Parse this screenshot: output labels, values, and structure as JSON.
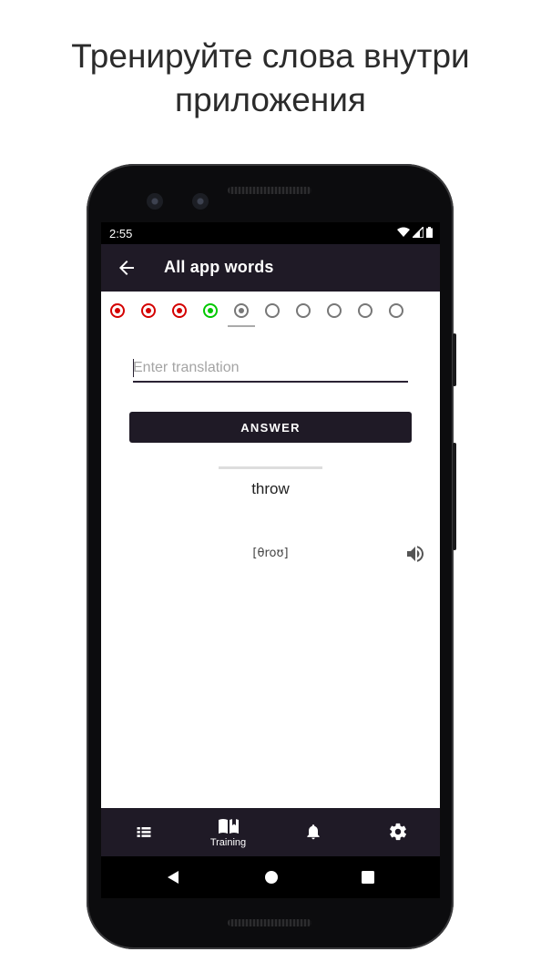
{
  "headline": {
    "line1": "Тренируйте слова внутри",
    "line2": "приложения"
  },
  "statusbar": {
    "time": "2:55",
    "icons": [
      "wifi-icon",
      "signal-icon",
      "battery-icon"
    ]
  },
  "appbar": {
    "title": "All app words",
    "back_icon": "arrow-back-icon",
    "background": "#1f1a26"
  },
  "progress": {
    "states": [
      "wrong",
      "wrong",
      "wrong",
      "correct",
      "current",
      "pending",
      "pending",
      "pending",
      "pending",
      "pending"
    ],
    "colors": {
      "wrong": "#d40000",
      "correct": "#00c800",
      "pending": "#777777"
    }
  },
  "training": {
    "input_placeholder": "Enter translation",
    "input_value": "",
    "answer_label": "ANSWER",
    "word": "throw",
    "transcription": "[θroʊ]",
    "speaker_icon": "volume-icon"
  },
  "bottom_nav": {
    "items": [
      {
        "icon": "list-icon",
        "label": ""
      },
      {
        "icon": "book-icon",
        "label": "Training"
      },
      {
        "icon": "bell-icon",
        "label": ""
      },
      {
        "icon": "gear-icon",
        "label": ""
      }
    ]
  },
  "system_nav": [
    "back-triangle-icon",
    "home-circle-icon",
    "recents-square-icon"
  ]
}
